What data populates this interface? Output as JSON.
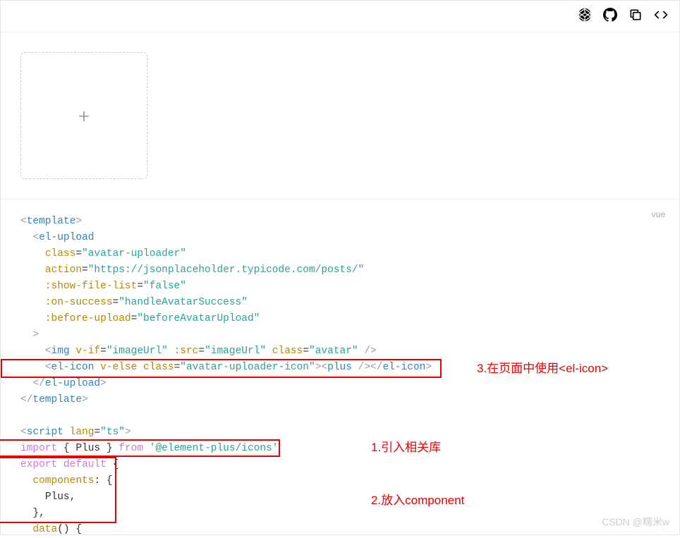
{
  "toolbar": {
    "icons": [
      "codepen-icon",
      "github-icon",
      "copy-icon",
      "code-icon"
    ]
  },
  "preview": {
    "upload_placeholder_glyph": "+"
  },
  "code": {
    "language_label": "vue",
    "lines": {
      "l1_open": "<template>",
      "l2": "  <el-upload",
      "l3_attr": "    class=",
      "l3_val": "\"avatar-uploader\"",
      "l4_attr": "    action=",
      "l4_val": "\"https://jsonplaceholder.typicode.com/posts/\"",
      "l5_attr": "    :show-file-list=",
      "l5_val": "\"false\"",
      "l6_attr": "    :on-success=",
      "l6_val": "\"handleAvatarSuccess\"",
      "l7_attr": "    :before-upload=",
      "l7_val": "\"beforeAvatarUpload\"",
      "l8": "  >",
      "l9": "    <img v-if=\"imageUrl\" :src=\"imageUrl\" class=\"avatar\" />",
      "l10": "    <el-icon v-else class=\"avatar-uploader-icon\"><plus /></el-icon>",
      "l11": "  </el-upload>",
      "l12": "</template>",
      "l14": "<script lang=\"ts\">",
      "l15": "import { Plus } from '@element-plus/icons'",
      "l16": "export default {",
      "l17": "  components: {",
      "l18": "    Plus,",
      "l19": "  },",
      "l20": "  data() {"
    }
  },
  "annotations": {
    "a1": "1.引入相关库",
    "a2": "2.放入component",
    "a3": "3.在页面中使用<el-icon>"
  },
  "watermark": "CSDN @糯米w"
}
